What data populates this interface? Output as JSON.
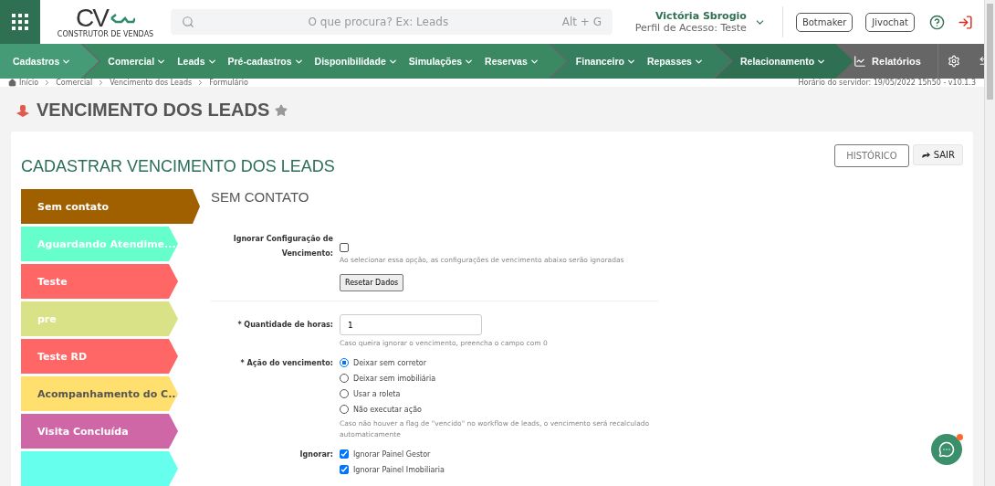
{
  "header": {
    "logo": {
      "text": "CV",
      "tagline": "CONSTRUTOR DE VENDAS"
    },
    "search": {
      "placeholder": "O que procura? Ex: Leads",
      "shortcut": "Alt + G"
    },
    "user": {
      "name": "Victória Sbrogio",
      "profile": "Perfil de Acesso: Teste"
    },
    "buttons": [
      "Botmaker",
      "Jivochat"
    ]
  },
  "nav": {
    "groups": [
      {
        "color": "#449b76",
        "items": [
          "Cadastros"
        ]
      },
      {
        "color": "#3a8963",
        "items": [
          "Comercial",
          "Leads",
          "Pré-cadastros",
          "Disponibilidade",
          "Simulações",
          "Reservas"
        ]
      },
      {
        "color": "#357f5e",
        "items": [
          "Financeiro",
          "Repasses"
        ]
      },
      {
        "color": "#2f6f52",
        "items": [
          "Relacionamento"
        ]
      }
    ],
    "reports": "Relatórios"
  },
  "breadcrumb": [
    "Início",
    "Comercial",
    "Vencimento dos Leads",
    "Formulário"
  ],
  "server_time": "Horário do servidor: 19/05/2022 15h50 - v10.1.3",
  "page_title": "VENCIMENTO DOS LEADS",
  "card": {
    "title": "CADASTRAR VENCIMENTO DOS LEADS",
    "buttons": {
      "history": "HISTÓRICO",
      "exit": "SAIR"
    }
  },
  "stages": [
    {
      "label": "Sem contato",
      "color": "#a06000",
      "kind": "light",
      "selected": true
    },
    {
      "label": "Aguardando Atendime...",
      "color": "#66ffcc",
      "kind": "light",
      "selected": false
    },
    {
      "label": "Teste",
      "color": "#ff6666",
      "kind": "light",
      "selected": false
    },
    {
      "label": "pre",
      "color": "#d9e287",
      "kind": "light",
      "selected": false
    },
    {
      "label": "Teste RD",
      "color": "#ff6666",
      "kind": "light",
      "selected": false
    },
    {
      "label": "Acompanhamento do C...",
      "color": "#ffdf6e",
      "kind": "dark",
      "selected": false
    },
    {
      "label": "Visita Concluída",
      "color": "#cf66a6",
      "kind": "light",
      "selected": false
    },
    {
      "color": "#66ffee",
      "kind": "light",
      "selected": false
    }
  ],
  "form": {
    "title": "SEM CONTATO",
    "ignore_config": {
      "label": "Ignorar Configuração de Vencimento:",
      "checked": false,
      "help": "Ao selecionar essa opção, as configurações de vencimento abaixo serão ignoradas",
      "reset_button": "Resetar Dados"
    },
    "hours": {
      "label": "* Quantidade de horas:",
      "value": "1",
      "help": "Caso queira ignorar o vencimento, preencha o campo com 0"
    },
    "action": {
      "label": "* Ação do vencimento:",
      "options": [
        {
          "label": "Deixar sem corretor",
          "selected": true
        },
        {
          "label": "Deixar sem imobiliária",
          "selected": false
        },
        {
          "label": "Usar a roleta",
          "selected": false
        },
        {
          "label": "Não executar ação",
          "selected": false
        }
      ],
      "help": "Caso não houver a flag de \"vencido\" no workflow de leads, o vencimento será recalculado automaticamente"
    },
    "ignore": {
      "label": "Ignorar:",
      "options": [
        {
          "label": "Ignorar Painel Gestor",
          "checked": true
        },
        {
          "label": "Ignorar Painel Imobiliaria",
          "checked": true
        }
      ]
    }
  }
}
